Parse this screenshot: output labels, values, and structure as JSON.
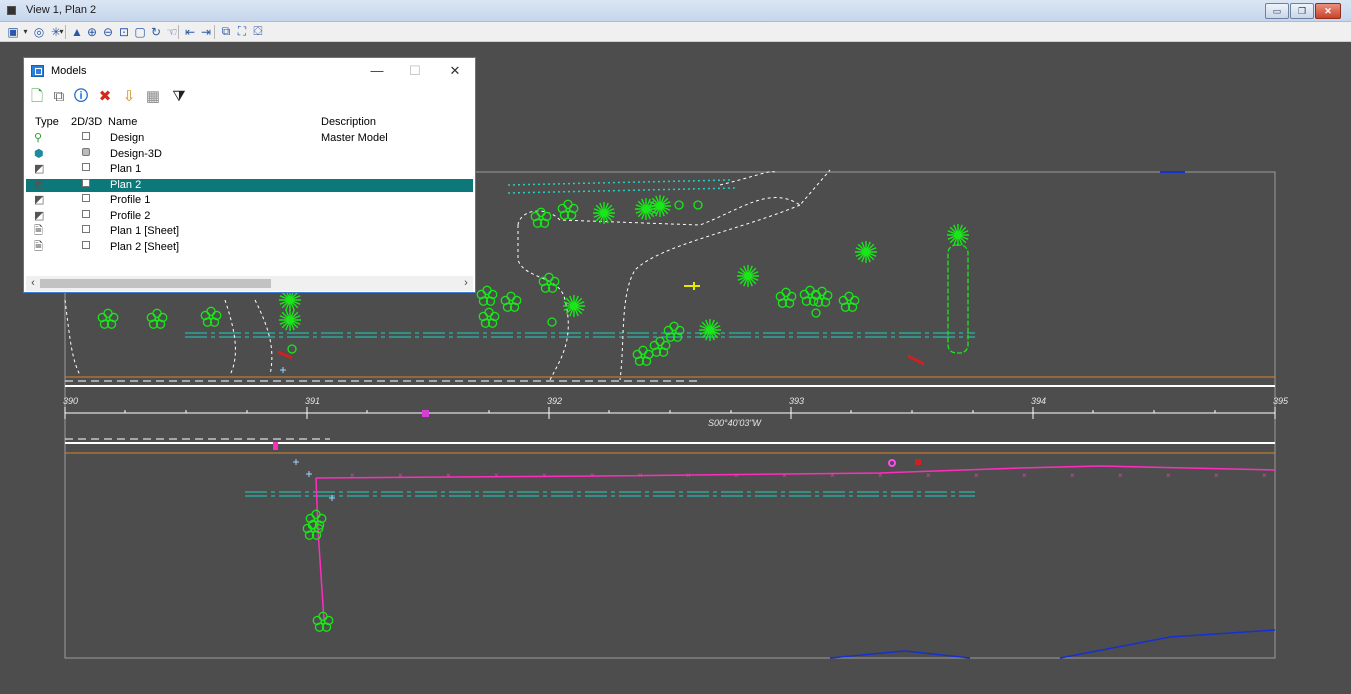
{
  "window": {
    "title": "View 1, Plan 2",
    "buttons": {
      "minimize": "▭",
      "restore": "❐",
      "close": "✕"
    }
  },
  "view_tools": [
    {
      "name": "view-attributes-icon",
      "glyph": "▣"
    },
    {
      "name": "dropdown-icon",
      "glyph": "▾"
    },
    {
      "name": "presentation-icon",
      "glyph": "◎"
    },
    {
      "name": "lighting-icon",
      "glyph": "✳"
    },
    {
      "name": "dropdown-icon",
      "glyph": "▾"
    },
    {
      "name": "update-view-icon",
      "glyph": "▲"
    },
    {
      "name": "zoom-in-icon",
      "glyph": "⊕"
    },
    {
      "name": "zoom-out-icon",
      "glyph": "⊖"
    },
    {
      "name": "window-area-icon",
      "glyph": "⊡"
    },
    {
      "name": "fit-view-icon",
      "glyph": "▢"
    },
    {
      "name": "rotate-view-icon",
      "glyph": "↻"
    },
    {
      "name": "pan-view-icon",
      "glyph": "☜"
    },
    {
      "name": "view-previous-icon",
      "glyph": "⇤"
    },
    {
      "name": "view-next-icon",
      "glyph": "⇥"
    },
    {
      "name": "copy-view-icon",
      "glyph": "⧉"
    },
    {
      "name": "clip-volume-icon",
      "glyph": "⛶"
    },
    {
      "name": "clip-mask-icon",
      "glyph": "⛋"
    }
  ],
  "models_dialog": {
    "title": "Models",
    "controls": {
      "minimize": "—",
      "maximize": "☐",
      "close": "✕"
    },
    "tools": [
      {
        "name": "create-model-icon",
        "glyph": "🗋",
        "color": "#2e9d3a"
      },
      {
        "name": "copy-model-icon",
        "glyph": "⧉",
        "color": "#666666"
      },
      {
        "name": "model-properties-icon",
        "glyph": "🛈",
        "color": "#1f6fd0"
      },
      {
        "name": "delete-model-icon",
        "glyph": "✖",
        "color": "#d22a1e"
      },
      {
        "name": "import-model-icon",
        "glyph": "⇩",
        "color": "#d68a14"
      },
      {
        "name": "select-all-icon",
        "glyph": "▦",
        "color": "#888888"
      },
      {
        "name": "filter-icon",
        "glyph": "⧩",
        "color": "#222222"
      }
    ],
    "columns": {
      "type": "Type",
      "dim": "2D/3D",
      "name": "Name",
      "description": "Description"
    },
    "rows": [
      {
        "icon": "design-model-icon",
        "glyph": "⚲",
        "color": "#2f9a2f",
        "dim": "2D",
        "name": "Design",
        "description": "Master Model",
        "selected": false
      },
      {
        "icon": "3d-model-icon",
        "glyph": "⬢",
        "color": "#1e8a9e",
        "dim": "3D",
        "name": "Design-3D",
        "description": "",
        "selected": false
      },
      {
        "icon": "drawing-model-icon",
        "glyph": "◩",
        "color": "#555555",
        "dim": "2D",
        "name": "Plan 1",
        "description": "",
        "selected": false
      },
      {
        "icon": "drawing-model-icon",
        "glyph": "◩",
        "color": "#555555",
        "dim": "2D",
        "name": "Plan 2",
        "description": "",
        "selected": true
      },
      {
        "icon": "drawing-model-icon",
        "glyph": "◩",
        "color": "#555555",
        "dim": "2D",
        "name": "Profile 1",
        "description": "",
        "selected": false
      },
      {
        "icon": "drawing-model-icon",
        "glyph": "◩",
        "color": "#555555",
        "dim": "2D",
        "name": "Profile 2",
        "description": "",
        "selected": false
      },
      {
        "icon": "sheet-model-icon",
        "glyph": "🗎",
        "color": "#444444",
        "dim": "2D",
        "name": "Plan 1 [Sheet]",
        "description": "",
        "selected": false
      },
      {
        "icon": "sheet-model-icon",
        "glyph": "🗎",
        "color": "#444444",
        "dim": "2D",
        "name": "Plan 2 [Sheet]",
        "description": "",
        "selected": false
      }
    ],
    "scroll_left": "‹",
    "scroll_right": "›"
  },
  "drawing": {
    "stations": [
      "390",
      "391",
      "392",
      "393",
      "394",
      "395"
    ],
    "bearing": "S00°40'03\"W",
    "colors": {
      "background": "#4d4d4d",
      "tree": "#18e818",
      "edge_of_pavement": "#ffffff",
      "right_of_way": "#d9822b",
      "hydrant_line": "#ff2dbd",
      "utility": "#1fd1c1",
      "property": "#1530d0"
    }
  }
}
